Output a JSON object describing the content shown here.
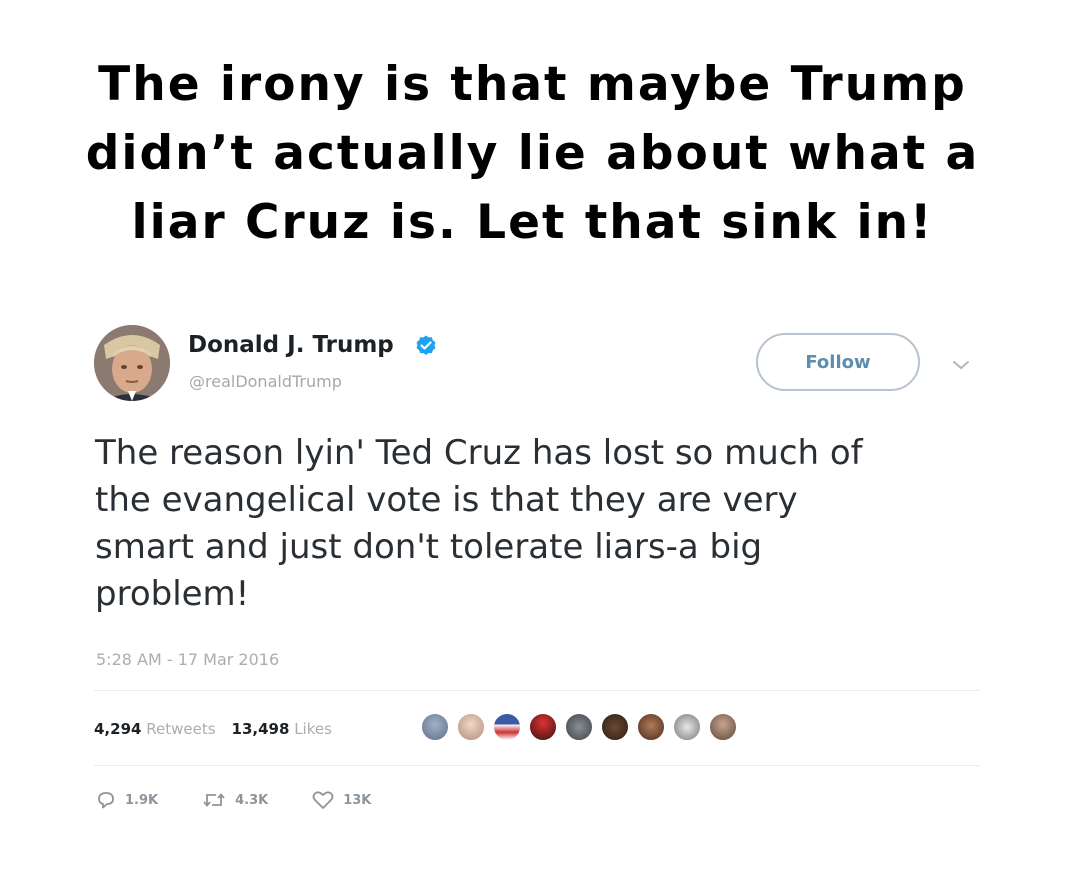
{
  "caption": {
    "lines": [
      "The irony is that maybe Trump",
      "didn’t actually lie about what a",
      "liar Cruz is.  Let that sink in!"
    ]
  },
  "tweet": {
    "display_name": "Donald J. Trump",
    "handle": "@realDonaldTrump",
    "follow_label": "Follow",
    "text_lines": [
      "The reason lyin' Ted Cruz has lost so much of",
      "the evangelical vote is that they are very",
      "smart and just don't tolerate liars-a big",
      "problem!"
    ],
    "timestamp": "5:28 AM - 17 Mar 2016",
    "retweets_count": "4,294",
    "retweets_label": "Retweets",
    "likes_count": "13,498",
    "likes_label": "Likes",
    "actions": {
      "replies": "1.9K",
      "retweets": "4.3K",
      "likes": "13K"
    }
  },
  "colors": {
    "verified": "#1da1f2",
    "follow_text": "#5d8db0",
    "muted_text": "#a9aeb3"
  },
  "icons": [
    "verified-badge-icon",
    "chevron-down-icon",
    "reply-icon",
    "retweet-icon",
    "heart-icon"
  ]
}
